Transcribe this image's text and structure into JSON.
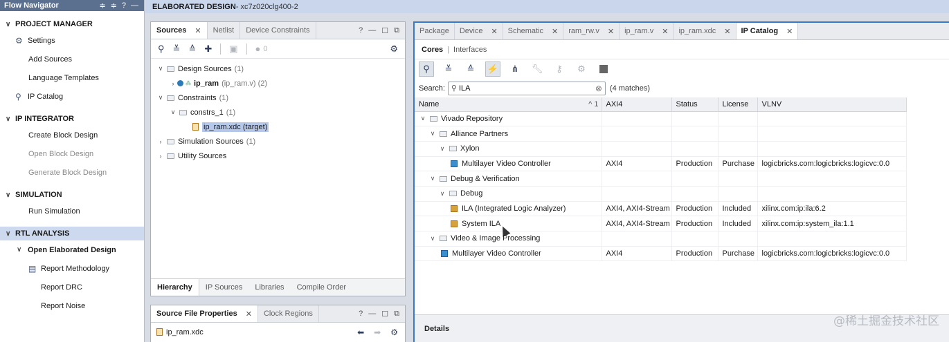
{
  "flow_navigator": {
    "title": "Flow Navigator",
    "tools": [
      "≑",
      "≑",
      "?",
      "—"
    ],
    "sections": [
      {
        "label": "PROJECT MANAGER",
        "items": [
          {
            "label": "Settings",
            "icon": "gear-icon",
            "disabled": false
          },
          {
            "label": "Add Sources",
            "disabled": false
          },
          {
            "label": "Language Templates",
            "disabled": false
          },
          {
            "label": "IP Catalog",
            "icon": "ip-catalog-icon",
            "disabled": false
          }
        ]
      },
      {
        "label": "IP INTEGRATOR",
        "items": [
          {
            "label": "Create Block Design",
            "disabled": false
          },
          {
            "label": "Open Block Design",
            "disabled": true
          },
          {
            "label": "Generate Block Design",
            "disabled": true
          }
        ]
      },
      {
        "label": "SIMULATION",
        "items": [
          {
            "label": "Run Simulation",
            "disabled": false
          }
        ]
      },
      {
        "label": "RTL ANALYSIS",
        "active": true,
        "items": [
          {
            "label": "Open Elaborated Design",
            "sub": true
          },
          {
            "label": "Report Methodology",
            "icon": "clipboard-icon"
          },
          {
            "label": "Report DRC"
          },
          {
            "label": "Report Noise"
          }
        ]
      }
    ]
  },
  "banner": {
    "title": "ELABORATED DESIGN",
    "subtitle": " - xc7z020clg400-2"
  },
  "sources": {
    "tabs": [
      "Sources",
      "Netlist",
      "Device Constraints"
    ],
    "badge_count": "0",
    "tree": [
      {
        "label": "Design Sources",
        "count": "(1)",
        "level": 0,
        "arrow": "v"
      },
      {
        "label": "ip_ram",
        "detail": "(ip_ram.v) (2)",
        "level": 1,
        "arrow": ">"
      },
      {
        "label": "Constraints",
        "count": "(1)",
        "level": 0,
        "arrow": "v"
      },
      {
        "label": "constrs_1",
        "count": "(1)",
        "level": 1,
        "arrow": "v"
      },
      {
        "label": "ip_ram.xdc (target)",
        "level": 2,
        "arrow": ""
      },
      {
        "label": "Simulation Sources",
        "count": "(1)",
        "level": 0,
        "arrow": ">"
      },
      {
        "label": "Utility Sources",
        "level": 0,
        "arrow": ">"
      }
    ],
    "bottom_tabs": [
      "Hierarchy",
      "IP Sources",
      "Libraries",
      "Compile Order"
    ]
  },
  "properties": {
    "tabs": [
      "Source File Properties",
      "Clock Regions"
    ],
    "file": "ip_ram.xdc"
  },
  "catalog": {
    "tabs": [
      "Package",
      "Device",
      "Schematic",
      "ram_rw.v",
      "ip_ram.v",
      "ip_ram.xdc",
      "IP Catalog"
    ],
    "subtabs": {
      "cores": "Cores",
      "interfaces": "Interfaces"
    },
    "search": {
      "label": "Search:",
      "value": "ILA",
      "matches": "(4 matches)"
    },
    "columns": [
      "Name",
      "AXI4",
      "Status",
      "License",
      "VLNV"
    ],
    "sort_indicator": "^ 1",
    "rows": [
      {
        "name": "Vivado Repository",
        "level": 0,
        "type": "folder"
      },
      {
        "name": "Alliance Partners",
        "level": 1,
        "type": "folder"
      },
      {
        "name": "Xylon",
        "level": 2,
        "type": "folder"
      },
      {
        "name": "Multilayer Video Controller",
        "level": 3,
        "type": "ip-blue",
        "axi": "AXI4",
        "status": "Production",
        "license": "Purchase",
        "vlnv": "logicbricks.com:logicbricks:logicvc:0.0"
      },
      {
        "name": "Debug & Verification",
        "level": 1,
        "type": "folder"
      },
      {
        "name": "Debug",
        "level": 2,
        "type": "folder"
      },
      {
        "name": "ILA (Integrated Logic Analyzer)",
        "level": 3,
        "type": "ip",
        "axi": "AXI4, AXI4-Stream",
        "status": "Production",
        "license": "Included",
        "vlnv": "xilinx.com:ip:ila:6.2"
      },
      {
        "name": "System ILA",
        "level": 3,
        "type": "ip",
        "axi": "AXI4, AXI4-Stream",
        "status": "Production",
        "license": "Included",
        "vlnv": "xilinx.com:ip:system_ila:1.1"
      },
      {
        "name": "Video & Image Processing",
        "level": 1,
        "type": "folder"
      },
      {
        "name": "Multilayer Video Controller",
        "level": 2,
        "type": "ip-blue",
        "axi": "AXI4",
        "status": "Production",
        "license": "Purchase",
        "vlnv": "logicbricks.com:logicbricks:logicvc:0.0"
      }
    ],
    "details_label": "Details"
  },
  "watermark": "@稀土掘金技术社区"
}
